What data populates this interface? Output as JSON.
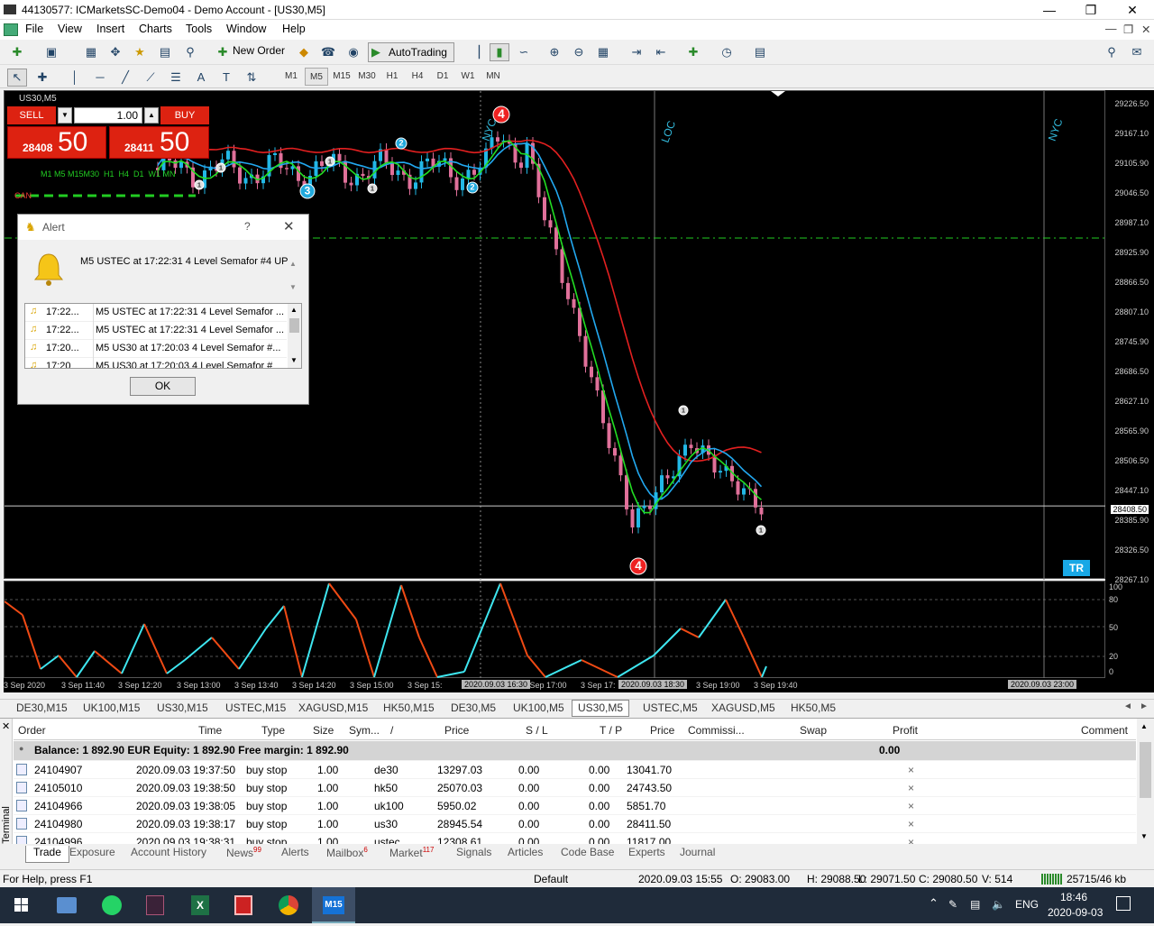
{
  "window": {
    "title": "44130577: ICMarketsSC-Demo04 - Demo Account - [US30,M5]"
  },
  "menu": [
    "File",
    "View",
    "Insert",
    "Charts",
    "Tools",
    "Window",
    "Help"
  ],
  "toolbar": {
    "new_order": "New Order",
    "auto_trading": "AutoTrading"
  },
  "timeframes": [
    "M1",
    "M5",
    "M15",
    "M30",
    "H1",
    "H4",
    "D1",
    "W1",
    "MN"
  ],
  "selected_timeframe": "M5",
  "chart": {
    "symbol_label": "US30,M5",
    "sell_label": "SELL",
    "buy_label": "BUY",
    "lot": "1.00",
    "sell_price_main": "28408",
    "sell_price_big": "50",
    "buy_price_main": "28411",
    "buy_price_big": "50",
    "tf_strip": "M1 M5 M15M30  H1  H4  D1  W1 MN",
    "can_label": "CAN",
    "session_labels": [
      "NYC",
      "LOC",
      "NYC"
    ],
    "tr_label": "TR",
    "semafor": [
      "4",
      "4",
      "3",
      "2",
      "2",
      "1",
      "1",
      "1",
      "1",
      "1",
      "1"
    ],
    "price_labels": [
      "29226.50",
      "29167.10",
      "29105.90",
      "29046.50",
      "28987.10",
      "28925.90",
      "28866.50",
      "28807.10",
      "28745.90",
      "28686.50",
      "28627.10",
      "28565.90",
      "28506.50",
      "28447.10",
      "28408.50",
      "28385.90",
      "28326.50",
      "28267.10"
    ],
    "current_price": "28408.50",
    "indicator_labels": [
      "100",
      "80",
      "50",
      "20",
      "0"
    ],
    "time_labels": [
      "3 Sep 2020",
      "3 Sep 11:40",
      "3 Sep 12:20",
      "3 Sep 13:00",
      "3 Sep 13:40",
      "3 Sep 14:20",
      "3 Sep 15:00",
      "3 Sep 15:",
      "3 Sep 17:00",
      "3 Sep 17:",
      "3 Sep 19:00",
      "3 Sep 19:40"
    ],
    "time_boxes": [
      "2020.09.03 16:30",
      "2020.09.03 18:30",
      "2020.09.03 23:00"
    ]
  },
  "chart_tabs": [
    "DE30,M15",
    "UK100,M15",
    "US30,M15",
    "USTEC,M15",
    "XAGUSD,M15",
    "HK50,M15",
    "DE30,M5",
    "UK100,M5",
    "US30,M5",
    "USTEC,M5",
    "XAGUSD,M5",
    "HK50,M5"
  ],
  "active_chart_tab": "US30,M5",
  "alert": {
    "title": "Alert",
    "help": "?",
    "message": "M5 USTEC at 17:22:31 4 Level Semafor   #4 UP",
    "rows": [
      {
        "time": "17:22...",
        "text": "M5 USTEC at 17:22:31 4 Level Semafor  ..."
      },
      {
        "time": "17:22...",
        "text": "M5 USTEC at 17:22:31 4 Level Semafor  ..."
      },
      {
        "time": "17:20...",
        "text": "M5 US30 at 17:20:03 4 Level Semafor   #..."
      },
      {
        "time": "17:20",
        "text": "M5 US30 at 17:20:03 4 Level Semafor   #"
      }
    ],
    "ok": "OK"
  },
  "terminal": {
    "headers": [
      "Order",
      "Time",
      "Type",
      "Size",
      "Sym...",
      "/",
      "Price",
      "S / L",
      "T / P",
      "Price",
      "Commissi...",
      "Swap",
      "Profit",
      "Comment"
    ],
    "balance_line": "Balance: 1 892.90 EUR  Equity: 1 892.90  Free margin: 1 892.90",
    "balance_profit": "0.00",
    "rows": [
      {
        "order": "24104907",
        "time": "2020.09.03 19:37:50",
        "type": "buy stop",
        "size": "1.00",
        "symbol": "de30",
        "price": "13297.03",
        "sl": "0.00",
        "tp": "0.00",
        "cur": "13041.70"
      },
      {
        "order": "24105010",
        "time": "2020.09.03 19:38:50",
        "type": "buy stop",
        "size": "1.00",
        "symbol": "hk50",
        "price": "25070.03",
        "sl": "0.00",
        "tp": "0.00",
        "cur": "24743.50"
      },
      {
        "order": "24104966",
        "time": "2020.09.03 19:38:05",
        "type": "buy stop",
        "size": "1.00",
        "symbol": "uk100",
        "price": "5950.02",
        "sl": "0.00",
        "tp": "0.00",
        "cur": "5851.70"
      },
      {
        "order": "24104980",
        "time": "2020.09.03 19:38:17",
        "type": "buy stop",
        "size": "1.00",
        "symbol": "us30",
        "price": "28945.54",
        "sl": "0.00",
        "tp": "0.00",
        "cur": "28411.50"
      },
      {
        "order": "24104996",
        "time": "2020.09.03 19:38:31",
        "type": "buy stop",
        "size": "1.00",
        "symbol": "ustec",
        "price": "12308.61",
        "sl": "0.00",
        "tp": "0.00",
        "cur": "11817.00"
      }
    ],
    "side_label": "Terminal"
  },
  "terminal_tabs": [
    {
      "label": "Trade",
      "badge": ""
    },
    {
      "label": "Exposure",
      "badge": ""
    },
    {
      "label": "Account History",
      "badge": ""
    },
    {
      "label": "News",
      "badge": "99"
    },
    {
      "label": "Alerts",
      "badge": ""
    },
    {
      "label": "Mailbox",
      "badge": "6"
    },
    {
      "label": "Market",
      "badge": "117"
    },
    {
      "label": "Signals",
      "badge": ""
    },
    {
      "label": "Articles",
      "badge": ""
    },
    {
      "label": "Code Base",
      "badge": ""
    },
    {
      "label": "Experts",
      "badge": ""
    },
    {
      "label": "Journal",
      "badge": ""
    }
  ],
  "status": {
    "help": "For Help, press F1",
    "profile": "Default",
    "datetime": "2020.09.03 15:55",
    "open": "O: 29083.00",
    "high": "H: 29088.50",
    "low": "L: 29071.50",
    "close": "C: 29080.50",
    "volume": "V: 514",
    "traffic": "25715/46 kb"
  },
  "taskbar": {
    "lang": "ENG",
    "time": "18:46",
    "date": "2020-09-03",
    "mt_label": "M15"
  }
}
